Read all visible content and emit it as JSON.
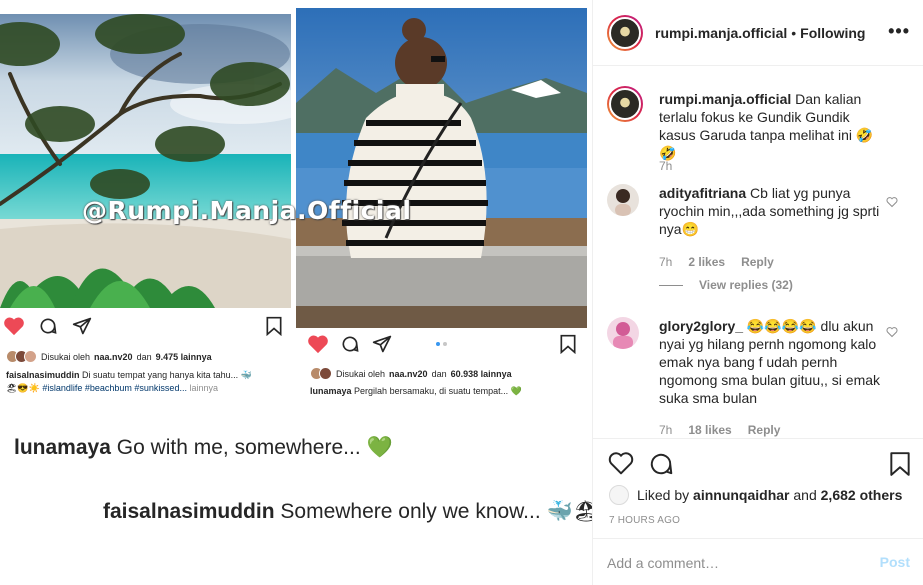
{
  "colors": {
    "like_red": "#ed4956",
    "link_blue": "#00376b",
    "muted": "#8e8e8e",
    "post_disabled": "#b2dffc",
    "emoji_heart_green": "#8cc63f"
  },
  "image_collage": {
    "watermark": "@Rumpi.Manja.Official",
    "left_post": {
      "liked_by_prefix": "Disukai oleh",
      "liked_by_user": "naa.nv20",
      "liked_by_and": "dan",
      "liked_by_count": "9.475 lainnya",
      "caption_user": "faisalnasimuddin",
      "caption_text": "Di suatu tempat yang hanya kita tahu... 🐳",
      "caption_line2_emoji": "🏖😎☀️",
      "caption_hashtags": "#islandlife #beachbum #sunkissed...",
      "caption_more": "lainnya",
      "icons": [
        "heart-icon",
        "comment-icon",
        "share-icon",
        "bookmark-icon"
      ]
    },
    "right_post": {
      "liked_by_prefix": "Disukai oleh",
      "liked_by_user": "naa.nv20",
      "liked_by_and": "dan",
      "liked_by_count": "60.938 lainnya",
      "caption_user": "lunamaya",
      "caption_text": "Pergilah bersamaku, di suatu tempat... 💚",
      "icons": [
        "heart-icon",
        "comment-icon",
        "share-icon",
        "bookmark-icon"
      ]
    },
    "big_comment_1": {
      "user": "lunamaya",
      "text": "Go with me, somewhere... 💚"
    },
    "big_comment_2": {
      "user": "faisalnasimuddin",
      "text": "Somewhere only we know... 🐳🏖😎"
    }
  },
  "header": {
    "username": "rumpi.manja.official",
    "separator": "•",
    "follow_status": "Following",
    "more_label": "•••"
  },
  "caption": {
    "username": "rumpi.manja.official",
    "text": "Dan kalian terlalu fokus ke Gundik Gundik kasus Garuda tanpa melihat ini 🤣🤣",
    "time": "7h"
  },
  "comments": [
    {
      "username": "adityafitriana",
      "text": "Cb liat yg punya ryochin min,,,ada something jg sprti nya😁",
      "time": "7h",
      "likes": "2 likes",
      "reply": "Reply",
      "view_replies": "View replies (32)"
    },
    {
      "username": "glory2glory_",
      "text": "😂😂😂😂 dlu akun nyai yg hilang pernh ngomong kalo emak nya bang f udah pernh ngomong sma bulan gituu,, si emak suka sma bulan",
      "time": "7h",
      "likes": "18 likes",
      "reply": "Reply"
    }
  ],
  "actions": {
    "icons": [
      "heart-icon",
      "comment-icon",
      "bookmark-icon"
    ]
  },
  "liked": {
    "prefix": "Liked by",
    "user": "ainnunqaidhar",
    "and": "and",
    "count": "2,682 others"
  },
  "post_time": "7 HOURS AGO",
  "add_comment": {
    "placeholder": "Add a comment…",
    "post_label": "Post"
  }
}
